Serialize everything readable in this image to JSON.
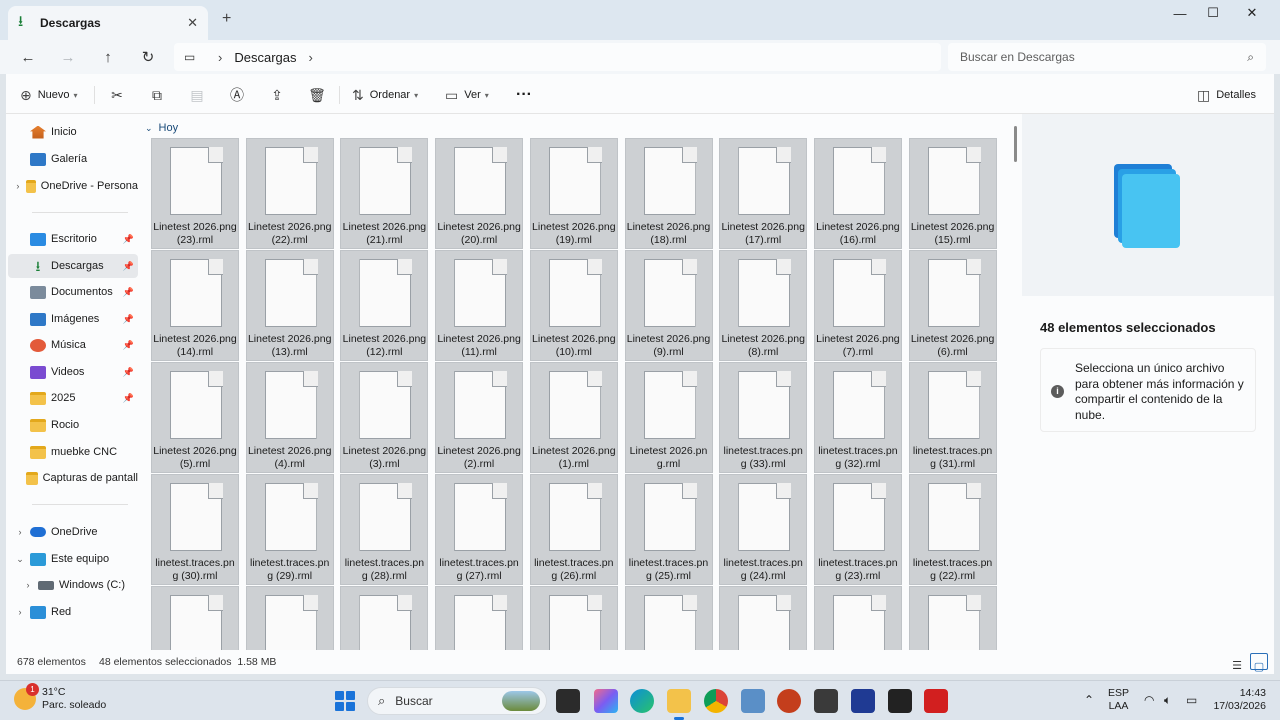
{
  "window": {
    "tab_title": "Descargas",
    "tab_icon": "download-icon",
    "new_tab": "+"
  },
  "address": {
    "breadcrumb": [
      "Descargas"
    ],
    "search_placeholder": "Buscar en Descargas"
  },
  "toolbar": {
    "new_label": "Nuevo",
    "sort_label": "Ordenar",
    "view_label": "Ver",
    "more_label": "···",
    "details_label": "Detalles"
  },
  "sidebar": {
    "items": [
      {
        "label": "Inicio",
        "icon": "home-icon"
      },
      {
        "label": "Galería",
        "icon": "gallery-icon"
      },
      {
        "label": "OneDrive - Persona",
        "icon": "folder-icon"
      },
      {
        "label": "Escritorio",
        "icon": "desktop-icon"
      },
      {
        "label": "Descargas",
        "icon": "download-icon"
      },
      {
        "label": "Documentos",
        "icon": "documents-icon"
      },
      {
        "label": "Imágenes",
        "icon": "pictures-icon"
      },
      {
        "label": "Música",
        "icon": "music-icon"
      },
      {
        "label": "Videos",
        "icon": "videos-icon"
      },
      {
        "label": "2025",
        "icon": "folder-icon"
      },
      {
        "label": "Rocio",
        "icon": "folder-icon"
      },
      {
        "label": "muebke CNC",
        "icon": "folder-icon"
      },
      {
        "label": "Capturas de pantall",
        "icon": "folder-icon"
      },
      {
        "label": "OneDrive",
        "icon": "onedrive-icon"
      },
      {
        "label": "Este equipo",
        "icon": "pc-icon"
      },
      {
        "label": "Windows (C:)",
        "icon": "drive-icon"
      },
      {
        "label": "Red",
        "icon": "network-icon"
      }
    ]
  },
  "content": {
    "group_label": "Hoy",
    "files": [
      "Linetest 2026.png (23).rml",
      "Linetest 2026.png (22).rml",
      "Linetest 2026.png (21).rml",
      "Linetest 2026.png (20).rml",
      "Linetest 2026.png (19).rml",
      "Linetest 2026.png (18).rml",
      "Linetest 2026.png (17).rml",
      "Linetest 2026.png (16).rml",
      "Linetest 2026.png (15).rml",
      "Linetest 2026.png (14).rml",
      "Linetest 2026.png (13).rml",
      "Linetest 2026.png (12).rml",
      "Linetest 2026.png (11).rml",
      "Linetest 2026.png (10).rml",
      "Linetest 2026.png (9).rml",
      "Linetest 2026.png (8).rml",
      "Linetest 2026.png (7).rml",
      "Linetest 2026.png (6).rml",
      "Linetest 2026.png (5).rml",
      "Linetest 2026.png (4).rml",
      "Linetest 2026.png (3).rml",
      "Linetest 2026.png (2).rml",
      "Linetest 2026.png (1).rml",
      "Linetest 2026.png.rml",
      "linetest.traces.png (33).rml",
      "linetest.traces.png (32).rml",
      "linetest.traces.png (31).rml",
      "linetest.traces.png (30).rml",
      "linetest.traces.png (29).rml",
      "linetest.traces.png (28).rml",
      "linetest.traces.png (27).rml",
      "linetest.traces.png (26).rml",
      "linetest.traces.png (25).rml",
      "linetest.traces.png (24).rml",
      "linetest.traces.png (23).rml",
      "linetest.traces.png (22).rml",
      "",
      "",
      "",
      "",
      "",
      "",
      "",
      "",
      ""
    ]
  },
  "details": {
    "count": "48 elementos seleccionados",
    "message": "Selecciona un único archivo para obtener más información y compartir el contenido de la nube."
  },
  "status": {
    "total": "678 elementos",
    "selected": "48 elementos seleccionados  1.58 MB"
  },
  "taskbar": {
    "temperature": "31°C",
    "weather": "Parc. soleado",
    "weather_badge": "1",
    "search_label": "Buscar",
    "lang_top": "ESP",
    "lang_bottom": "LAA",
    "time": "14:43",
    "date": "17/03/2026"
  },
  "colors": {
    "accent": "#1a73d9",
    "tile_selected": "#cdd0d3",
    "download_green": "#1a7f37"
  }
}
